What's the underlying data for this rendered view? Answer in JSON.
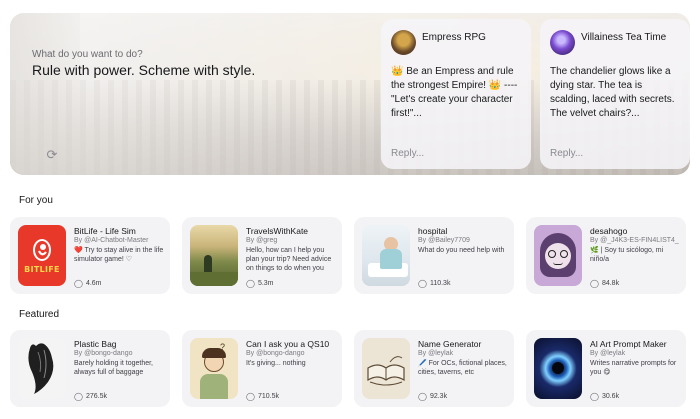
{
  "hero": {
    "question": "What do you want to do?",
    "title": "Rule with power. Scheme with style.",
    "cards": [
      {
        "name": "Empress RPG",
        "message": "👑 Be an Empress and rule the strongest Empire! 👑 ---- \"Let's create your character first!\"...",
        "reply": "Reply..."
      },
      {
        "name": "Villainess Tea Time",
        "message": "The chandelier glows like a dying star. The tea is scalding, laced with secrets. The velvet chairs?...",
        "reply": "Reply..."
      }
    ]
  },
  "sections": {
    "for_you": "For you",
    "featured": "Featured"
  },
  "for_you": [
    {
      "title": "BitLife - Life Sim",
      "by": "By @AI-Chatbot-Master",
      "desc": "❤️ Try to stay alive in the life simulator game! ♡",
      "count": "4.6m",
      "thumb_text": "BITLIFE"
    },
    {
      "title": "TravelsWithKate",
      "by": "By @greg",
      "desc": "Hello, how can I help you plan your trip? Need advice on things to do when you travel?...",
      "count": "5.3m"
    },
    {
      "title": "hospital",
      "by": "By @Bailey7709",
      "desc": "What do you need help with",
      "count": "110.3k"
    },
    {
      "title": "desahogo",
      "by": "By @_J4K3-ES-FIN4LIST4_",
      "desc": "🌿 | Soy tu sicólogo, mi niño/a",
      "count": "84.8k"
    }
  ],
  "featured": [
    {
      "title": "Plastic Bag",
      "by": "By @bongo-dango",
      "desc": "Barely holding it together, always full of baggage",
      "count": "276.5k"
    },
    {
      "title": "Can I ask you a QS10",
      "by": "By @bongo-dango",
      "desc": "It's giving... nothing",
      "count": "710.5k"
    },
    {
      "title": "Name Generator",
      "by": "By @leylak",
      "desc": "🖊️ For OCs, fictional places, cities, taverns, etc",
      "count": "92.3k"
    },
    {
      "title": "AI Art Prompt Maker",
      "by": "By @leylak",
      "desc": "Writes narrative prompts for you 😋",
      "count": "30.6k"
    }
  ],
  "colors": {
    "card_bg": "#f3f3f5",
    "bitlife_red": "#e8382a",
    "text_primary": "#18181b",
    "text_muted": "#7a7a80"
  }
}
